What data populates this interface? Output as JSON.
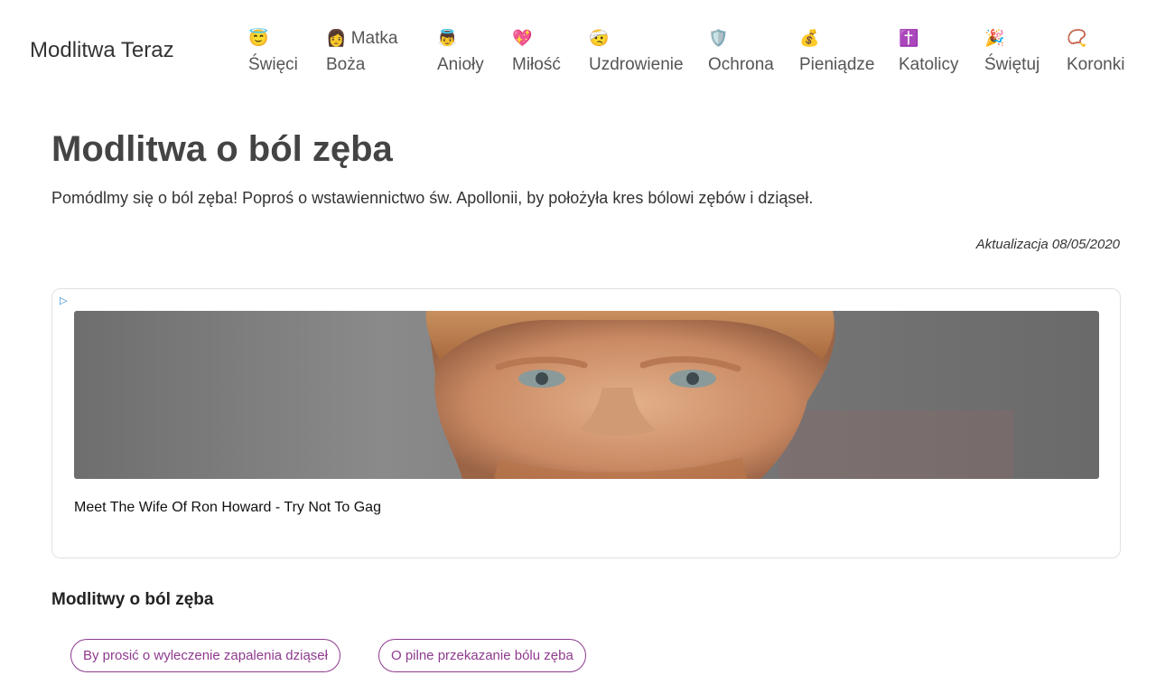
{
  "header": {
    "brand": "Modlitwa Teraz",
    "nav": [
      {
        "icon": "😇",
        "icon_name": "smiling-halo-icon",
        "label1": "",
        "label2": "Święci"
      },
      {
        "icon": "👩",
        "icon_name": "woman-icon",
        "label1": "Matka",
        "label2": "Boża"
      },
      {
        "icon": "👼",
        "icon_name": "baby-angel-icon",
        "label1": "",
        "label2": "Anioły"
      },
      {
        "icon": "💖",
        "icon_name": "sparkling-heart-icon",
        "label1": "",
        "label2": "Miłość"
      },
      {
        "icon": "🤕",
        "icon_name": "bandaged-face-icon",
        "label1": "",
        "label2": "Uzdrowienie"
      },
      {
        "icon": "🛡️",
        "icon_name": "shield-icon",
        "label1": "",
        "label2": "Ochrona"
      },
      {
        "icon": "💰",
        "icon_name": "money-bag-icon",
        "label1": "",
        "label2": "Pieniądze"
      },
      {
        "icon": "✝️",
        "icon_name": "latin-cross-icon",
        "label1": "",
        "label2": "Katolicy"
      },
      {
        "icon": "🎉",
        "icon_name": "party-popper-icon",
        "label1": "",
        "label2": "Świętuj"
      },
      {
        "icon": "📿",
        "icon_name": "rosary-icon",
        "label1": "",
        "label2": "Koronki"
      }
    ]
  },
  "main": {
    "title": "Modlitwa o ból zęba",
    "lead": "Pomódlmy się o ból zęba! Poproś o wstawiennictwo św. Apollonii, by położyła kres bólowi zębów i dziąseł.",
    "updated": "Aktualizacja 08/05/2020"
  },
  "ad": {
    "choice_icon": "▷",
    "headline": "Meet The Wife Of Ron Howard - Try Not To Gag"
  },
  "related": {
    "title": "Modlitwy o ból zęba",
    "links": [
      "By prosić o wyleczenie zapalenia dziąseł",
      "O pilne przekazanie bólu zęba"
    ]
  },
  "colors": {
    "accent": "#8e3a8e",
    "ad_choice": "#2a8ad4"
  }
}
